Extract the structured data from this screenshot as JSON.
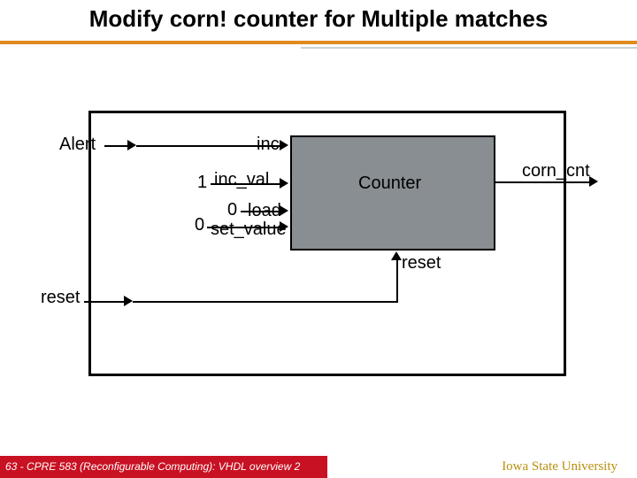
{
  "title": "Modify corn! counter for Multiple matches",
  "diagram": {
    "outer_block": "Counter",
    "signals": {
      "alert": "Alert",
      "inc": "inc",
      "inc_val": "inc_val",
      "inc_val_const": "1",
      "load": "load",
      "load_const": "0",
      "set_value": "set_value",
      "set_value_const": "0",
      "reset_out": "reset",
      "reset_in": "reset",
      "corn_cnt": "corn_cnt"
    }
  },
  "footer": {
    "left": "63 - CPRE 583 (Reconfigurable Computing):  VHDL overview 2",
    "right": "Iowa State University"
  }
}
